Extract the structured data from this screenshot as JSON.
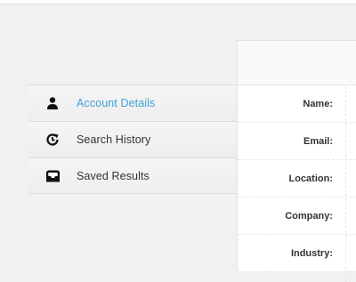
{
  "sidebar": {
    "items": [
      {
        "label": "Account Details",
        "icon": "user-icon",
        "active": true
      },
      {
        "label": "Search History",
        "icon": "history-icon",
        "active": false
      },
      {
        "label": "Saved Results",
        "icon": "inbox-tray-icon",
        "active": false
      }
    ]
  },
  "details": {
    "fields": [
      {
        "label": "Name:"
      },
      {
        "label": "Email:"
      },
      {
        "label": "Location:"
      },
      {
        "label": "Company:"
      },
      {
        "label": "Industry:"
      }
    ]
  },
  "colors": {
    "accent": "#3e9fd6",
    "text": "#333333",
    "background": "#f1f1f1"
  }
}
